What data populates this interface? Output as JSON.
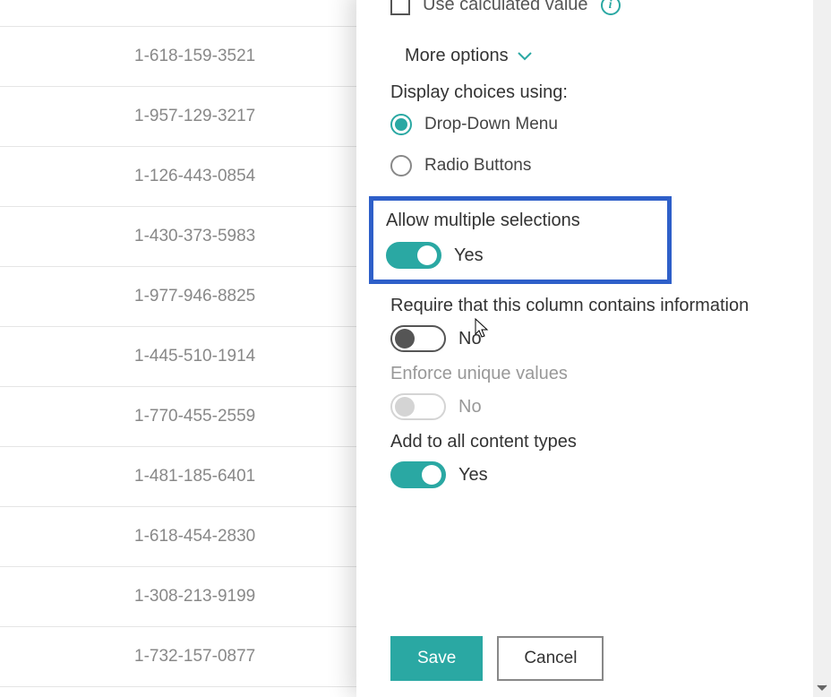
{
  "background": {
    "phone_numbers": [
      "1-618-159-3521",
      "1-957-129-3217",
      "1-126-443-0854",
      "1-430-373-5983",
      "1-977-946-8825",
      "1-445-510-1914",
      "1-770-455-2559",
      "1-481-185-6401",
      "1-618-454-2830",
      "1-308-213-9199",
      "1-732-157-0877"
    ]
  },
  "panel": {
    "use_calculated_value_label": "Use calculated value",
    "more_options_label": "More options",
    "display_choices_heading": "Display choices using:",
    "display_choices": {
      "drop_down": "Drop-Down Menu",
      "radio_buttons": "Radio Buttons"
    },
    "allow_multiple": {
      "label": "Allow multiple selections",
      "value": "Yes"
    },
    "require_info": {
      "label": "Require that this column contains information",
      "value": "No"
    },
    "enforce_unique": {
      "label": "Enforce unique values",
      "value": "No"
    },
    "add_to_content_types": {
      "label": "Add to all content types",
      "value": "Yes"
    },
    "buttons": {
      "save": "Save",
      "cancel": "Cancel"
    }
  }
}
